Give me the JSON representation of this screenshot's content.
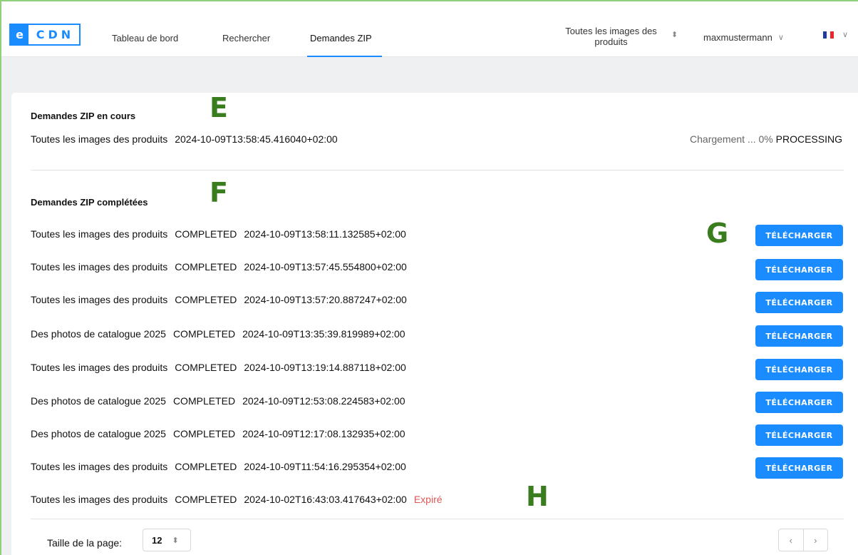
{
  "logo": {
    "e": "e",
    "cdn": "CDN"
  },
  "nav": {
    "tabs": [
      "Tableau de bord",
      "Rechercher",
      "Demandes ZIP"
    ],
    "active": "Demandes ZIP"
  },
  "scope": {
    "label": "Toutes les images des produits",
    "icon": "up-down-chevron-icon"
  },
  "user": {
    "name": "maxmustermann",
    "icon": "chevron-down-icon"
  },
  "lang": {
    "flag": "france-flag-icon",
    "flag_colors": [
      "#1f3b9e",
      "#ffffff",
      "#e8262e"
    ]
  },
  "in_progress": {
    "title": "Demandes ZIP en cours",
    "item": {
      "name": "Toutes les images des produits",
      "timestamp": "2024-10-09T13:58:45.416040+02:00",
      "progress_label": "Chargement ... 0%",
      "status": "PROCESSING"
    }
  },
  "completed": {
    "title": "Demandes ZIP complétées",
    "items": [
      {
        "name": "Toutes les images des produits",
        "status": "COMPLETED",
        "timestamp": "2024-10-09T13:58:11.132585+02:00",
        "action": "TÉLÉCHARGER"
      },
      {
        "name": "Toutes les images des produits",
        "status": "COMPLETED",
        "timestamp": "2024-10-09T13:57:45.554800+02:00",
        "action": "TÉLÉCHARGER"
      },
      {
        "name": "Toutes les images des produits",
        "status": "COMPLETED",
        "timestamp": "2024-10-09T13:57:20.887247+02:00",
        "action": "TÉLÉCHARGER"
      },
      {
        "name": "Des photos de catalogue 2025",
        "status": "COMPLETED",
        "timestamp": "2024-10-09T13:35:39.819989+02:00",
        "action": "TÉLÉCHARGER"
      },
      {
        "name": "Toutes les images des produits",
        "status": "COMPLETED",
        "timestamp": "2024-10-09T13:19:14.887118+02:00",
        "action": "TÉLÉCHARGER"
      },
      {
        "name": "Des photos de catalogue 2025",
        "status": "COMPLETED",
        "timestamp": "2024-10-09T12:53:08.224583+02:00",
        "action": "TÉLÉCHARGER"
      },
      {
        "name": "Des photos de catalogue 2025",
        "status": "COMPLETED",
        "timestamp": "2024-10-09T12:17:08.132935+02:00",
        "action": "TÉLÉCHARGER"
      },
      {
        "name": "Toutes les images des produits",
        "status": "COMPLETED",
        "timestamp": "2024-10-09T11:54:16.295354+02:00",
        "action": "TÉLÉCHARGER"
      },
      {
        "name": "Toutes les images des produits",
        "status": "COMPLETED",
        "timestamp": "2024-10-02T16:43:03.417643+02:00",
        "expired_label": "Expiré"
      }
    ]
  },
  "annotations": {
    "e": "E",
    "f": "F",
    "g": "G",
    "h": "H"
  },
  "footer": {
    "page_size_label": "Taille de la page:",
    "page_size_value": "12",
    "prev_label": "‹",
    "next_label": "›"
  },
  "colors": {
    "accent": "#1a8cff",
    "expired": "#e05757",
    "annotation": "#3a7d1f"
  }
}
